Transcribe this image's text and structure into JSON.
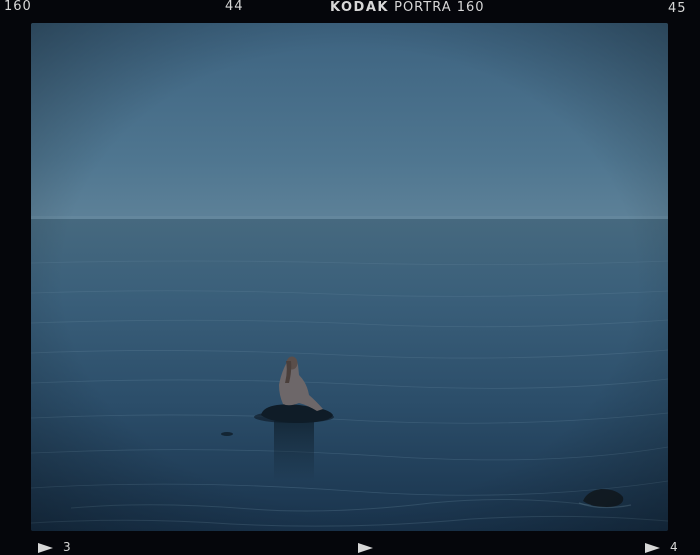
{
  "film_edge": {
    "top_left_number": "160",
    "top_center_number": "44",
    "brand_bold": "KODAK",
    "brand_rest": "PORTRA 160",
    "top_right_number": "45",
    "bottom_left_frame": "3",
    "bottom_right_frame": "4"
  },
  "photo": {
    "subject": "figure seated on rock in calm sea at dusk",
    "colors": {
      "sky_top": "#3f6582",
      "sky_horizon": "#5a7e96",
      "sea_far": "#3f6480",
      "sea_near": "#1a3550",
      "rock": "#0e1a24",
      "figure": "#6e6a6c"
    }
  }
}
